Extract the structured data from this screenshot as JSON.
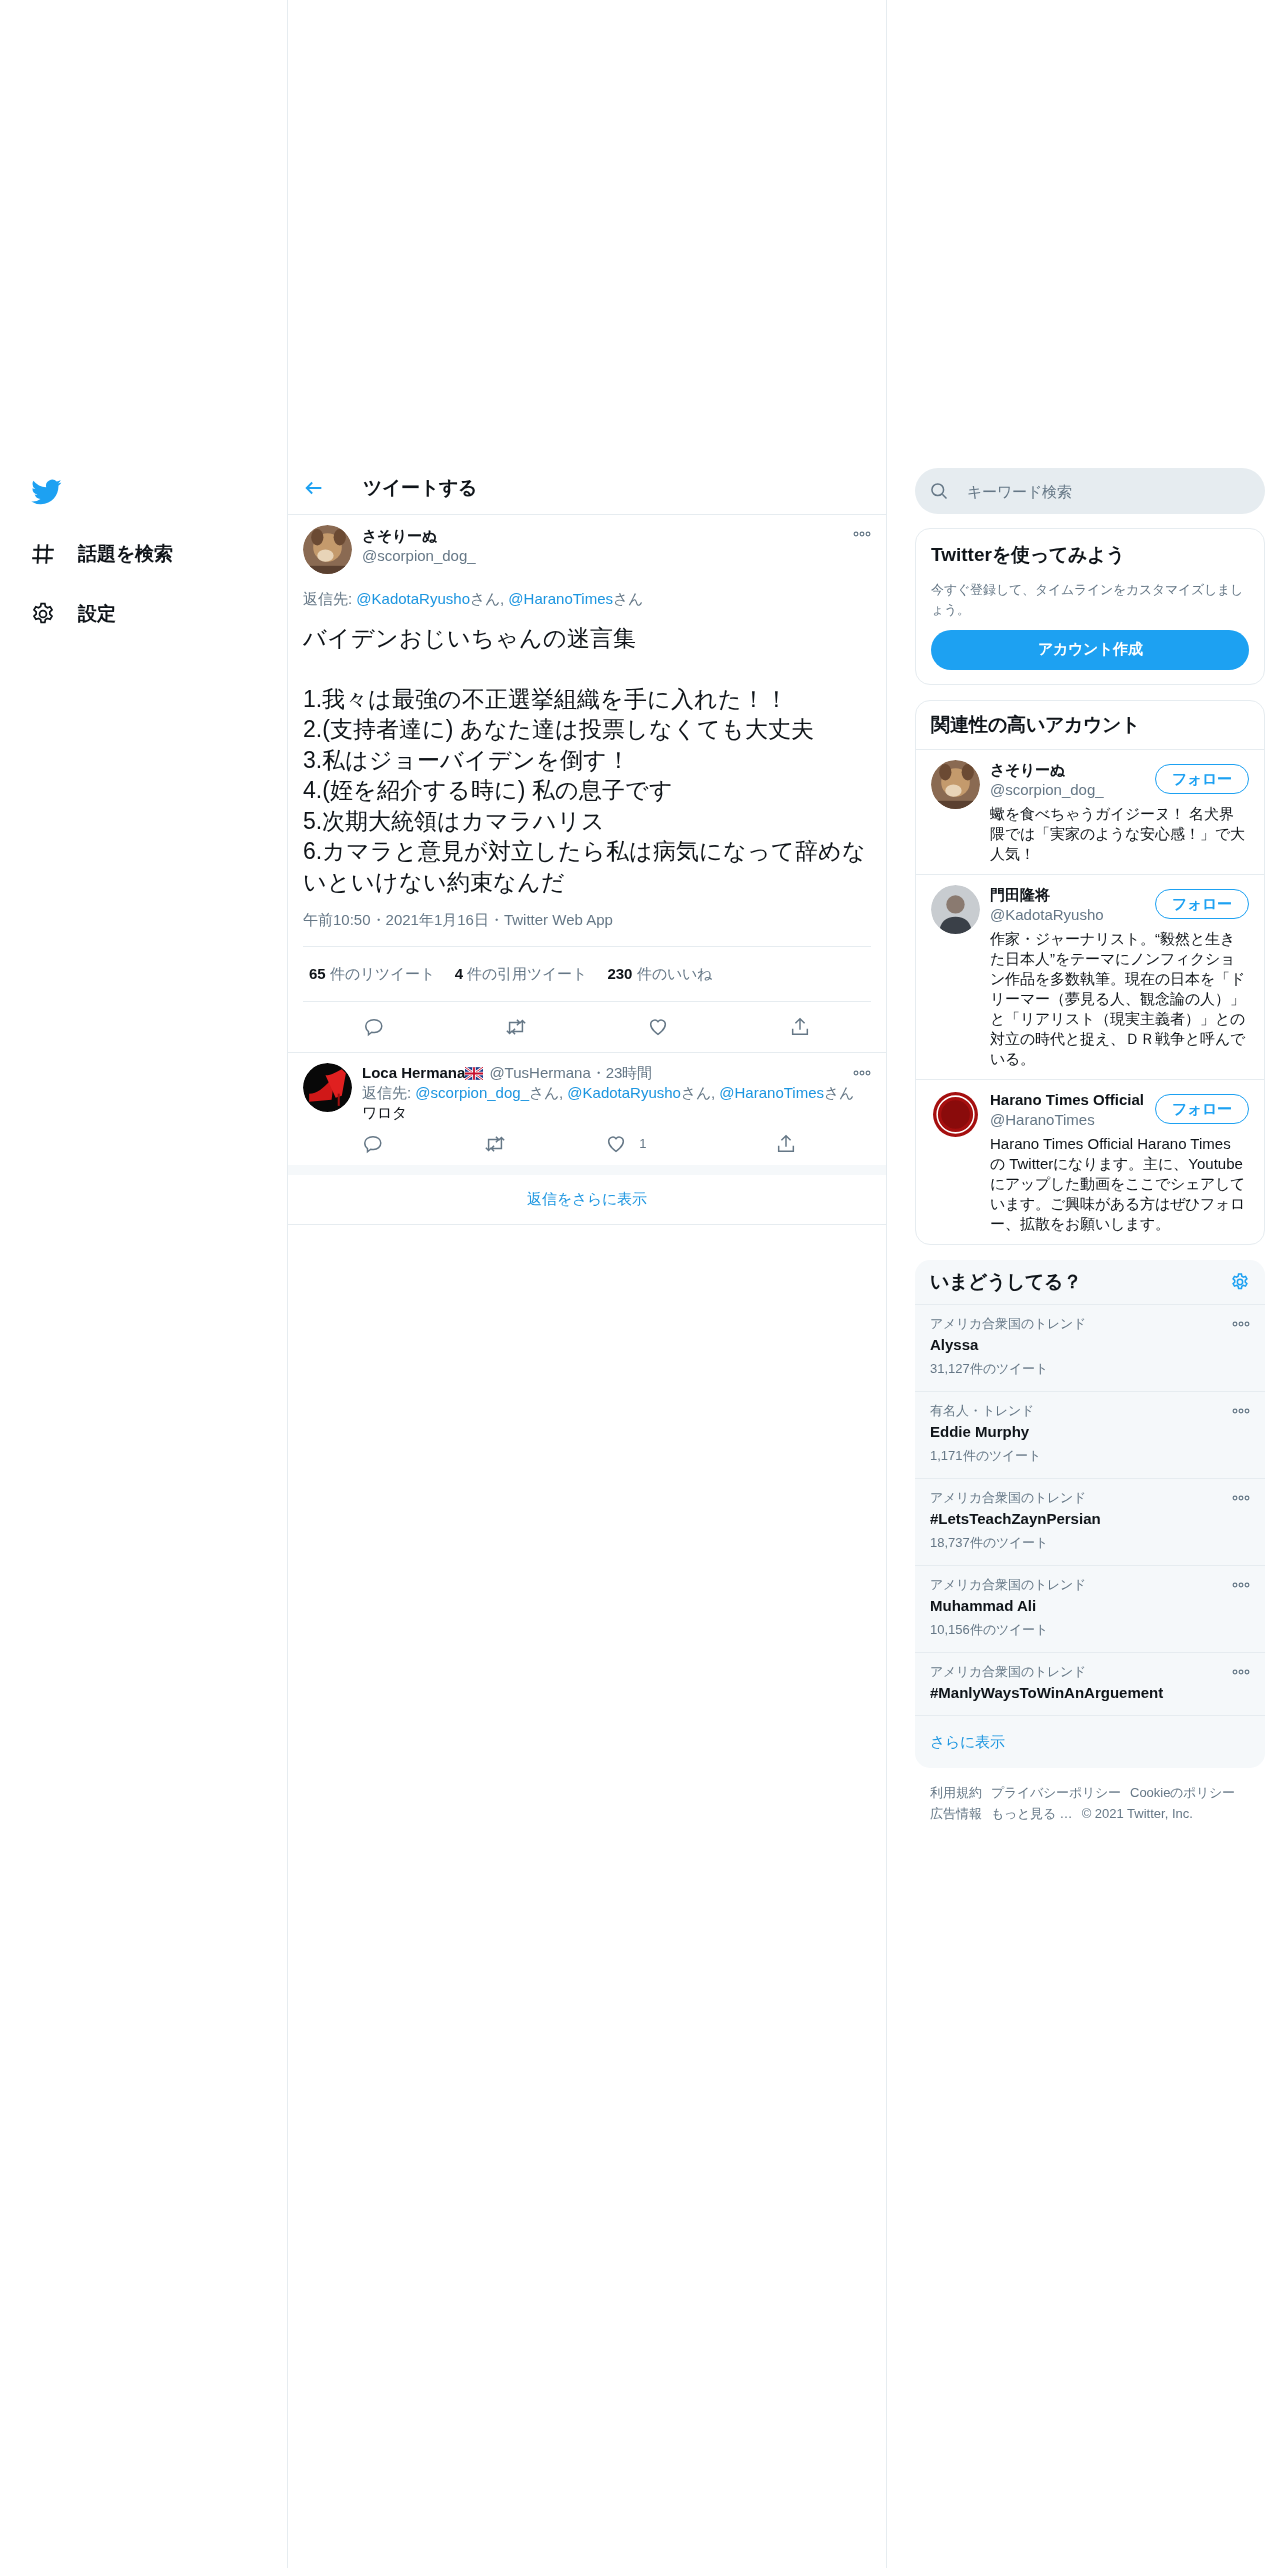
{
  "sidebar": {
    "items": [
      {
        "kind": "hashtag",
        "label": "話題を検索"
      },
      {
        "kind": "settings",
        "label": "設定"
      }
    ]
  },
  "header": {
    "title": "ツイートする"
  },
  "tweet": {
    "name": "さそりーぬ",
    "handle": "@scorpion_dog_",
    "reply_to": [
      {
        "kind": "plain",
        "text": "返信先: "
      },
      {
        "kind": "link",
        "text": "@KadotaRyusho"
      },
      {
        "kind": "plain",
        "text": "さん, "
      },
      {
        "kind": "link",
        "text": "@HaranoTimes"
      },
      {
        "kind": "plain",
        "text": "さん"
      }
    ],
    "text": "バイデンおじいちゃんの迷言集\n\n1.我々は最強の不正選挙組織を手に入れた！！\n2.(支持者達に) あなた達は投票しなくても大丈夫\n3.私はジョーバイデンを倒す！\n4.(姪を紹介する時に) 私の息子です\n5.次期大統領はカマラハリス\n6.カマラと意見が対立したら私は病気になって辞めないといけない約束なんだ",
    "meta": "午前10:50・2021年1月16日・Twitter Web App",
    "stats": [
      {
        "count": "65",
        "label": "件のリツイート"
      },
      {
        "count": "4",
        "label": "件の引用ツイート"
      },
      {
        "count": "230",
        "label": "件のいいね"
      }
    ]
  },
  "replies": [
    {
      "name": "Loca Hermana",
      "handle": "@TusHermana",
      "time": "・23時間",
      "reply_to": [
        {
          "kind": "plain",
          "text": "返信先: "
        },
        {
          "kind": "link",
          "text": "@scorpion_dog_"
        },
        {
          "kind": "plain",
          "text": "さん, "
        },
        {
          "kind": "link",
          "text": "@KadotaRyusho"
        },
        {
          "kind": "plain",
          "text": "さん, "
        },
        {
          "kind": "link",
          "text": "@HaranoTimes"
        },
        {
          "kind": "plain",
          "text": "さん"
        }
      ],
      "text": "ワロタ",
      "like_count": "1"
    }
  ],
  "show_more_replies": "返信をさらに表示",
  "search": {
    "placeholder": "キーワード検索"
  },
  "signup_card": {
    "title": "Twitterを使ってみよう",
    "text": "今すぐ登録して、タイムラインをカスタマイズしましょう。",
    "button": "アカウント作成"
  },
  "related_accounts": {
    "title": "関連性の高いアカウント",
    "accounts": [
      {
        "kind": "dog",
        "name": "さそりーぬ",
        "handle": "@scorpion_dog_",
        "follow": "フォロー",
        "bio": "蠍を食べちゃうガイジーヌ！ 名犬界隈では「実家のような安心感！」で大人気！"
      },
      {
        "kind": "person",
        "name": "門田隆将",
        "handle": "@KadotaRyusho",
        "follow": "フォロー",
        "bio": "作家・ジャーナリスト。“毅然と生きた日本人”をテーマにノンフィクション作品を多数執筆。現在の日本を「ドリーマー（夢見る人、観念論の人）」と「リアリスト（現実主義者）」との対立の時代と捉え、ＤＲ戦争と呼んでいる。"
      },
      {
        "kind": "logo",
        "name": "Harano Times Official",
        "handle": "@HaranoTimes",
        "follow": "フォロー",
        "bio": "Harano Times Official Harano Times の Twitterになります。主に、Youtubeにアップした動画をここでシェアしています。ご興味がある方はぜひフォロー、拡散をお願いします。"
      }
    ]
  },
  "trends": {
    "title": "いまどうしてる？",
    "items": [
      {
        "context": "アメリカ合衆国のトレンド",
        "name": "Alyssa",
        "count": "31,127件のツイート"
      },
      {
        "context": "有名人・トレンド",
        "name": "Eddie Murphy",
        "count": "1,171件のツイート"
      },
      {
        "context": "アメリカ合衆国のトレンド",
        "name": "#LetsTeachZaynPersian",
        "count": "18,737件のツイート"
      },
      {
        "context": "アメリカ合衆国のトレンド",
        "name": "Muhammad Ali",
        "count": "10,156件のツイート"
      },
      {
        "context": "アメリカ合衆国のトレンド",
        "name": "#ManlyWaysToWinAnArguement"
      }
    ],
    "show_more": "さらに表示"
  },
  "footer": {
    "links": [
      "利用規約",
      "プライバシーポリシー",
      "Cookieのポリシー",
      "広告情報",
      "もっと見る …"
    ],
    "copyright": "© 2021 Twitter, Inc."
  }
}
